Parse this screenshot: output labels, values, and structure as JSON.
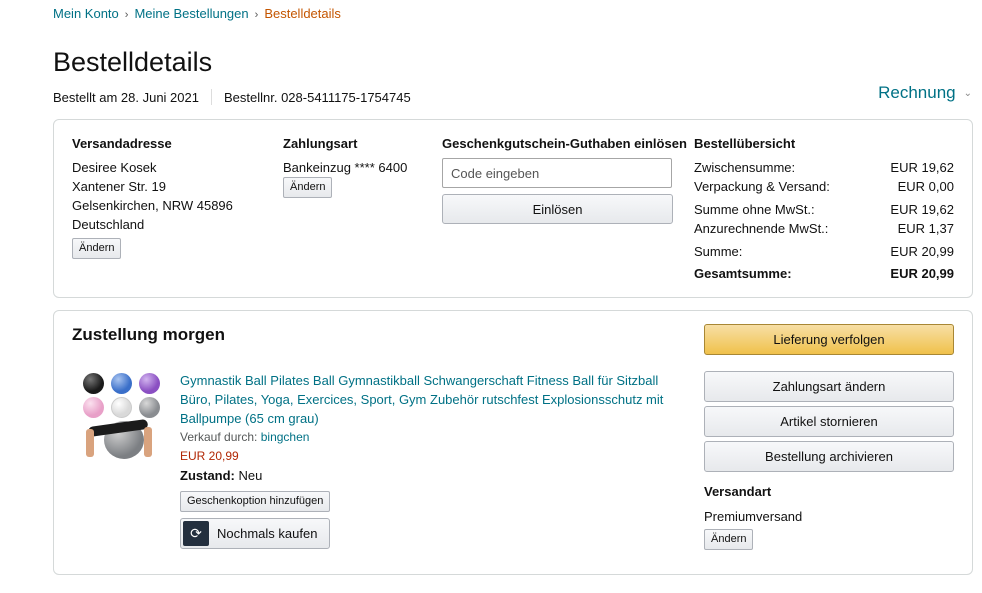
{
  "breadcrumb": {
    "items": [
      {
        "label": "Mein Konto"
      },
      {
        "label": "Meine Bestellungen"
      },
      {
        "label": "Bestelldetails"
      }
    ],
    "separator": "›"
  },
  "page_title": "Bestelldetails",
  "order_meta": {
    "ordered_on": "Bestellt am 28. Juni 2021",
    "order_number": "Bestellnr. 028-5411175-1754745"
  },
  "invoice": {
    "label": "Rechnung",
    "icon": "chevron-down-icon"
  },
  "shipping_address": {
    "heading": "Versandadresse",
    "lines": [
      "Desiree Kosek",
      "Xantener Str. 19",
      "Gelsenkirchen, NRW 45896",
      "Deutschland"
    ],
    "change_label": "Ändern"
  },
  "payment": {
    "heading": "Zahlungsart",
    "method": "Bankeinzug **** 6400",
    "change_label": "Ändern"
  },
  "gift_card": {
    "heading": "Geschenkgutschein-Guthaben einlösen",
    "placeholder": "Code eingeben",
    "redeem_label": "Einlösen"
  },
  "order_summary": {
    "heading": "Bestellübersicht",
    "rows": [
      {
        "label": "Zwischensumme:",
        "value": "EUR 19,62"
      },
      {
        "label": "Verpackung & Versand:",
        "value": "EUR 0,00"
      },
      {
        "label": "Summe ohne MwSt.:",
        "value": "EUR 19,62"
      },
      {
        "label": "Anzurechnende MwSt.:",
        "value": "EUR 1,37"
      },
      {
        "label": "Summe:",
        "value": "EUR 20,99"
      },
      {
        "label": "Gesamtsumme:",
        "value": "EUR 20,99"
      }
    ]
  },
  "shipment": {
    "title": "Zustellung morgen",
    "product": {
      "title": "Gymnastik Ball Pilates Ball Gymnastikball Schwangerschaft Fitness Ball für Sitzball Büro, Pilates, Yoga, Exercices, Sport, Gym Zubehör rutschfest Explosionsschutz mit Ballpumpe (65 cm grau)",
      "sold_by_label": "Verkauf durch:",
      "seller": "bingchen",
      "price": "EUR 20,99",
      "condition_label": "Zustand:",
      "condition": "Neu",
      "gift_option_label": "Geschenkoption hinzufügen",
      "buy_again_label": "Nochmals kaufen",
      "image_ball_colors": [
        "#1a1a1a",
        "#3a6fc9",
        "#8a4fc2",
        "#e8a0c8",
        "#e2e2e2",
        "#8a8d91"
      ]
    },
    "actions": {
      "track": "Lieferung verfolgen",
      "change_payment": "Zahlungsart ändern",
      "cancel_items": "Artikel stornieren",
      "archive_order": "Bestellung archivieren"
    },
    "shipping_method": {
      "heading": "Versandart",
      "value": "Premiumversand",
      "change_label": "Ändern"
    }
  },
  "colors": {
    "link": "#007185",
    "current_crumb": "#c45500",
    "price": "#b12704",
    "primary_button": "#f0c14b",
    "border": "#d5d9d9"
  }
}
